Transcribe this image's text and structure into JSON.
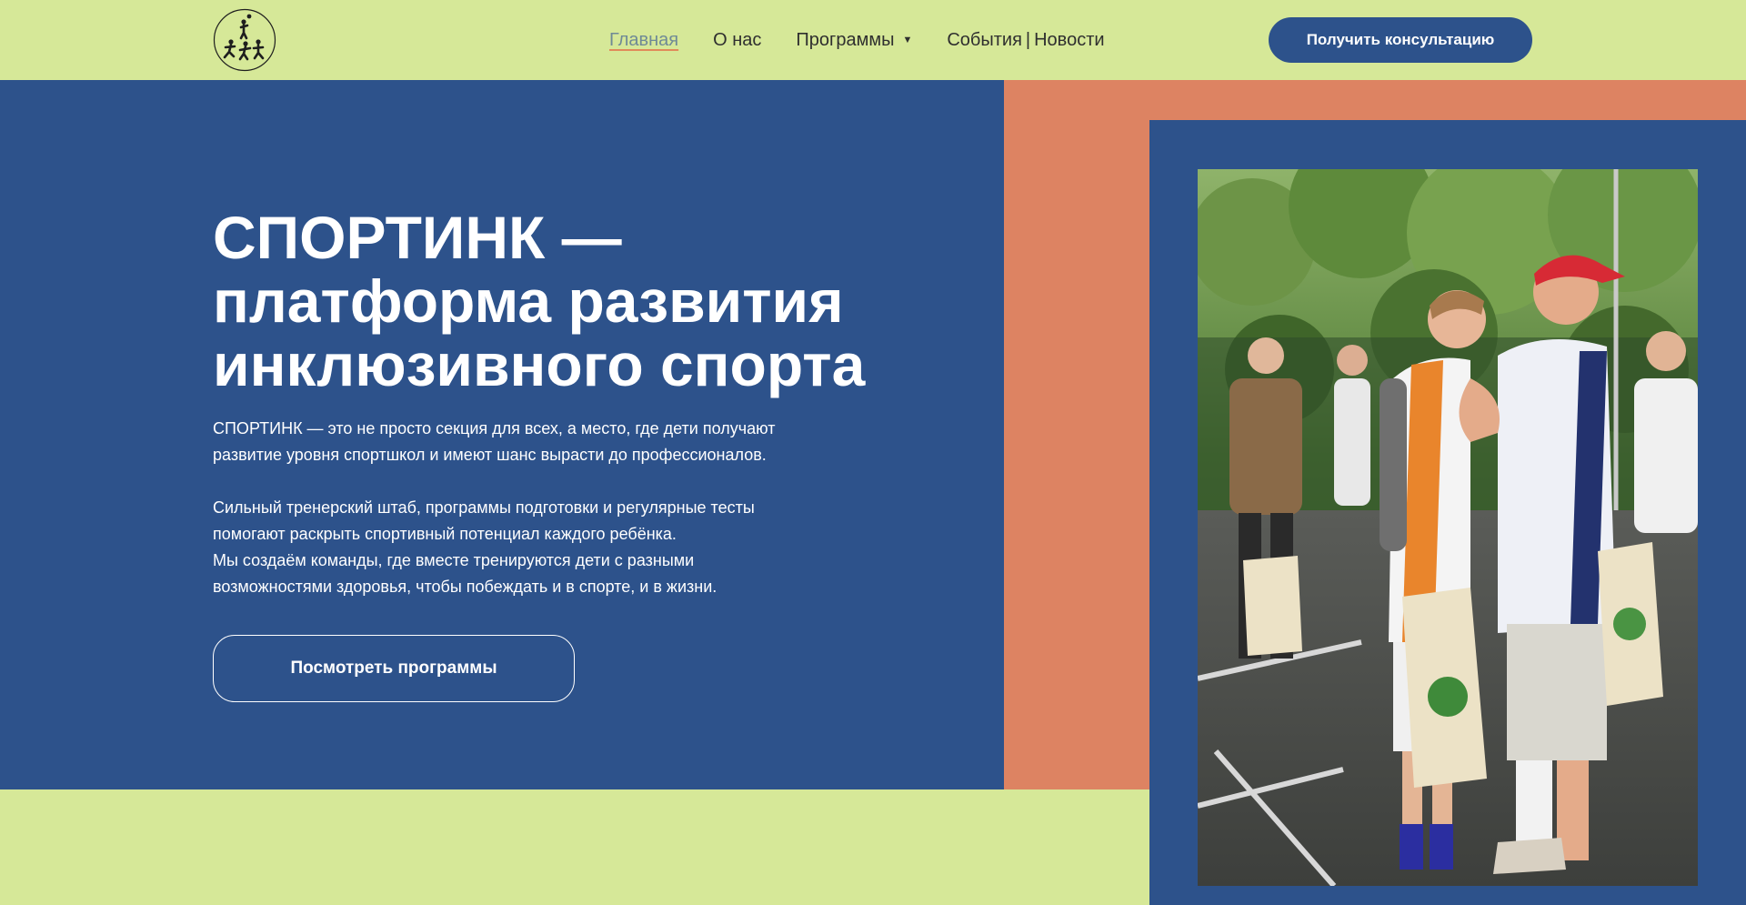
{
  "header": {
    "nav": [
      {
        "label": "Главная"
      },
      {
        "label": "О нас"
      },
      {
        "label": "Программы"
      },
      {
        "label": "События"
      },
      {
        "label": "Новости"
      }
    ],
    "nav_separator": "|",
    "cta_label": "Получить консультацию"
  },
  "hero": {
    "title_lines": [
      "СПОРТИНК —",
      "платформа развития",
      "инклюзивного спорта"
    ],
    "paragraph1_lines": [
      "СПОРТИНК — это не просто секция для всех, а место, где дети получают",
      "развитие уровня спортшкол и имеют шанс вырасти до профессионалов."
    ],
    "paragraph2_lines": [
      "Сильный тренерский штаб, программы подготовки и регулярные тесты",
      "помогают раскрыть спортивный потенциал каждого ребёнка.",
      "Мы создаём команды, где вместе тренируются дети с разными",
      "возможностями здоровья, чтобы побеждать и в спорте, и в жизни."
    ],
    "button_label": "Посмотреть программы"
  },
  "icons": {
    "logo": "sport-figures-logo-icon",
    "dropdown": "caret-down-icon"
  },
  "colors": {
    "green": "#d6e898",
    "blue": "#2d528b",
    "orange": "#dd8362",
    "active_underline": "#e08b5a"
  }
}
